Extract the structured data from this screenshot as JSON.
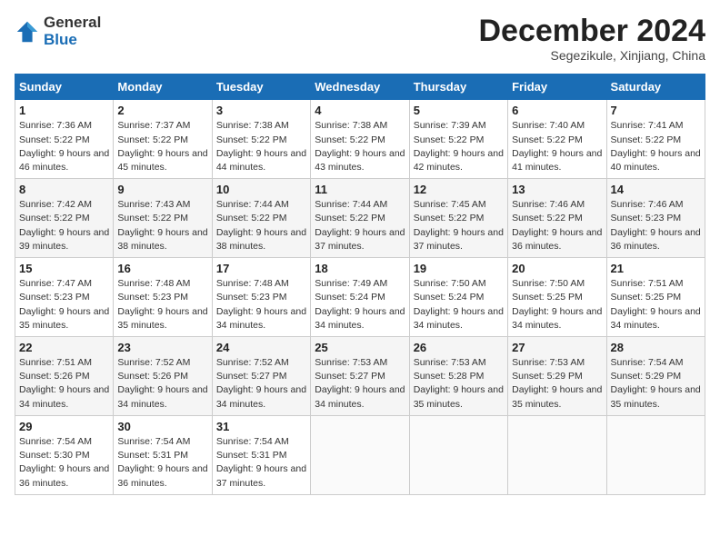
{
  "logo": {
    "general": "General",
    "blue": "Blue"
  },
  "title": "December 2024",
  "subtitle": "Segezikule, Xinjiang, China",
  "weekdays": [
    "Sunday",
    "Monday",
    "Tuesday",
    "Wednesday",
    "Thursday",
    "Friday",
    "Saturday"
  ],
  "weeks": [
    [
      {
        "day": "1",
        "sunrise": "7:36 AM",
        "sunset": "5:22 PM",
        "daylight": "9 hours and 46 minutes."
      },
      {
        "day": "2",
        "sunrise": "7:37 AM",
        "sunset": "5:22 PM",
        "daylight": "9 hours and 45 minutes."
      },
      {
        "day": "3",
        "sunrise": "7:38 AM",
        "sunset": "5:22 PM",
        "daylight": "9 hours and 44 minutes."
      },
      {
        "day": "4",
        "sunrise": "7:38 AM",
        "sunset": "5:22 PM",
        "daylight": "9 hours and 43 minutes."
      },
      {
        "day": "5",
        "sunrise": "7:39 AM",
        "sunset": "5:22 PM",
        "daylight": "9 hours and 42 minutes."
      },
      {
        "day": "6",
        "sunrise": "7:40 AM",
        "sunset": "5:22 PM",
        "daylight": "9 hours and 41 minutes."
      },
      {
        "day": "7",
        "sunrise": "7:41 AM",
        "sunset": "5:22 PM",
        "daylight": "9 hours and 40 minutes."
      }
    ],
    [
      {
        "day": "8",
        "sunrise": "7:42 AM",
        "sunset": "5:22 PM",
        "daylight": "9 hours and 39 minutes."
      },
      {
        "day": "9",
        "sunrise": "7:43 AM",
        "sunset": "5:22 PM",
        "daylight": "9 hours and 38 minutes."
      },
      {
        "day": "10",
        "sunrise": "7:44 AM",
        "sunset": "5:22 PM",
        "daylight": "9 hours and 38 minutes."
      },
      {
        "day": "11",
        "sunrise": "7:44 AM",
        "sunset": "5:22 PM",
        "daylight": "9 hours and 37 minutes."
      },
      {
        "day": "12",
        "sunrise": "7:45 AM",
        "sunset": "5:22 PM",
        "daylight": "9 hours and 37 minutes."
      },
      {
        "day": "13",
        "sunrise": "7:46 AM",
        "sunset": "5:22 PM",
        "daylight": "9 hours and 36 minutes."
      },
      {
        "day": "14",
        "sunrise": "7:46 AM",
        "sunset": "5:23 PM",
        "daylight": "9 hours and 36 minutes."
      }
    ],
    [
      {
        "day": "15",
        "sunrise": "7:47 AM",
        "sunset": "5:23 PM",
        "daylight": "9 hours and 35 minutes."
      },
      {
        "day": "16",
        "sunrise": "7:48 AM",
        "sunset": "5:23 PM",
        "daylight": "9 hours and 35 minutes."
      },
      {
        "day": "17",
        "sunrise": "7:48 AM",
        "sunset": "5:23 PM",
        "daylight": "9 hours and 34 minutes."
      },
      {
        "day": "18",
        "sunrise": "7:49 AM",
        "sunset": "5:24 PM",
        "daylight": "9 hours and 34 minutes."
      },
      {
        "day": "19",
        "sunrise": "7:50 AM",
        "sunset": "5:24 PM",
        "daylight": "9 hours and 34 minutes."
      },
      {
        "day": "20",
        "sunrise": "7:50 AM",
        "sunset": "5:25 PM",
        "daylight": "9 hours and 34 minutes."
      },
      {
        "day": "21",
        "sunrise": "7:51 AM",
        "sunset": "5:25 PM",
        "daylight": "9 hours and 34 minutes."
      }
    ],
    [
      {
        "day": "22",
        "sunrise": "7:51 AM",
        "sunset": "5:26 PM",
        "daylight": "9 hours and 34 minutes."
      },
      {
        "day": "23",
        "sunrise": "7:52 AM",
        "sunset": "5:26 PM",
        "daylight": "9 hours and 34 minutes."
      },
      {
        "day": "24",
        "sunrise": "7:52 AM",
        "sunset": "5:27 PM",
        "daylight": "9 hours and 34 minutes."
      },
      {
        "day": "25",
        "sunrise": "7:53 AM",
        "sunset": "5:27 PM",
        "daylight": "9 hours and 34 minutes."
      },
      {
        "day": "26",
        "sunrise": "7:53 AM",
        "sunset": "5:28 PM",
        "daylight": "9 hours and 35 minutes."
      },
      {
        "day": "27",
        "sunrise": "7:53 AM",
        "sunset": "5:29 PM",
        "daylight": "9 hours and 35 minutes."
      },
      {
        "day": "28",
        "sunrise": "7:54 AM",
        "sunset": "5:29 PM",
        "daylight": "9 hours and 35 minutes."
      }
    ],
    [
      {
        "day": "29",
        "sunrise": "7:54 AM",
        "sunset": "5:30 PM",
        "daylight": "9 hours and 36 minutes."
      },
      {
        "day": "30",
        "sunrise": "7:54 AM",
        "sunset": "5:31 PM",
        "daylight": "9 hours and 36 minutes."
      },
      {
        "day": "31",
        "sunrise": "7:54 AM",
        "sunset": "5:31 PM",
        "daylight": "9 hours and 37 minutes."
      },
      null,
      null,
      null,
      null
    ]
  ]
}
